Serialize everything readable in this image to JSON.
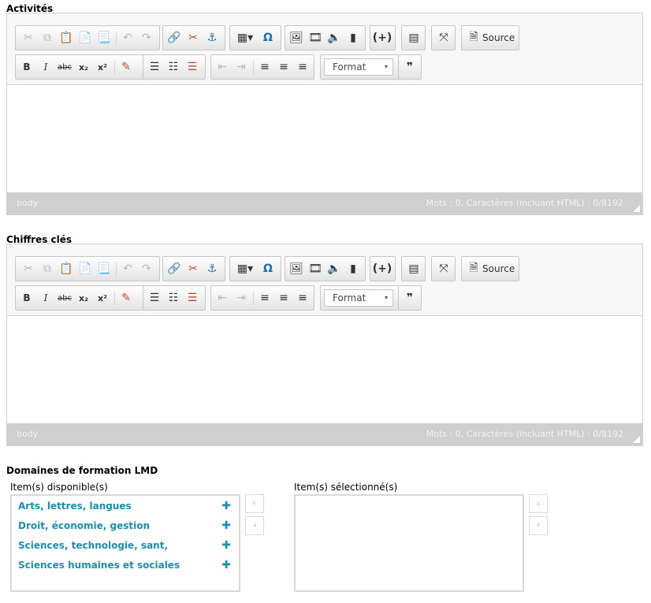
{
  "sections": {
    "activites": "Activités",
    "chiffres": "Chiffres clés",
    "domaines": "Domaines de formation LMD"
  },
  "editor": {
    "source_label": "Source",
    "format_label": "Format",
    "format_caret": "▾",
    "bold": "B",
    "italic": "I",
    "strike": "abc",
    "subscript": "x₂",
    "superscript": "x²",
    "omega": "Ω",
    "blockquote": "❞",
    "status_path": "body",
    "status_count": "Mots : 0, Caractères (incluant HTML) : 0/8192"
  },
  "icons": {
    "cut": "scissors-icon",
    "copy": "copy-icon",
    "paste": "paste-icon",
    "paste_text": "paste-text-icon",
    "paste_word": "paste-word-icon",
    "undo": "undo-icon",
    "redo": "redo-icon",
    "link": "link-icon",
    "unlink": "unlink-icon",
    "anchor": "anchor-icon",
    "table": "table-icon",
    "image": "image-icon",
    "video": "video-icon",
    "audio": "audio-icon",
    "iframe": "iframe-icon",
    "placeholder": "placeholder-icon",
    "pagebreak": "pagebreak-icon",
    "maximize": "maximize-icon",
    "remove_format": "eraser-icon"
  },
  "dual_list": {
    "available_title": "Item(s) disponible(s)",
    "selected_title": "Item(s) sélectionné(s)",
    "available_items": [
      "Arts, lettres, langues",
      "Droit, économie, gestion",
      "Sciences, technologie, sant,",
      "Sciences humaines et sociales"
    ],
    "add_symbol": "✚",
    "move_right": "▸",
    "move_left": "◂",
    "move_up": "▴",
    "move_down": "▾"
  },
  "colors": {
    "accent": "#1a8fb0",
    "toolbar_bg": "#f8f8f8",
    "status_bg": "#cfcfcf"
  }
}
